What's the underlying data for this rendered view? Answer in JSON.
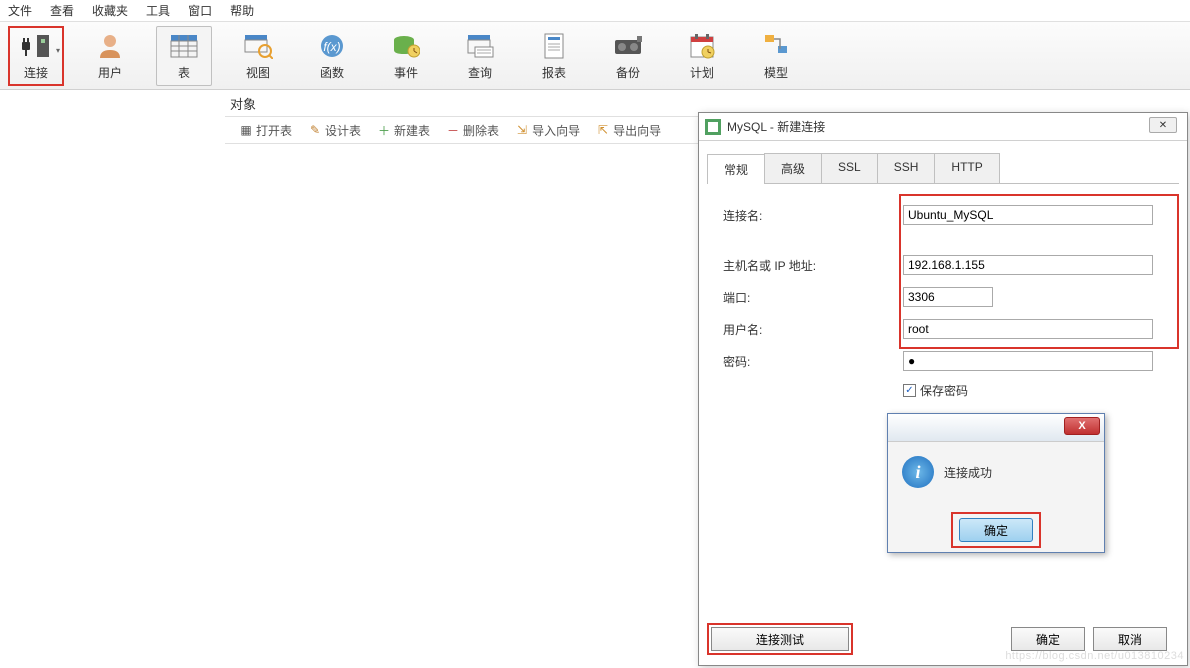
{
  "menu": {
    "file": "文件",
    "view": "查看",
    "favorites": "收藏夹",
    "tools": "工具",
    "window": "窗口",
    "help": "帮助"
  },
  "toolbar": {
    "connect": "连接",
    "user": "用户",
    "table": "表",
    "viewobj": "视图",
    "function": "函数",
    "event": "事件",
    "query": "查询",
    "report": "报表",
    "backup": "备份",
    "schedule": "计划",
    "model": "模型"
  },
  "sidebar": {
    "objects": "对象"
  },
  "subtool": {
    "open_table": "打开表",
    "design_table": "设计表",
    "new_table": "新建表",
    "delete_table": "删除表",
    "import_wizard": "导入向导",
    "export_wizard": "导出向导"
  },
  "dialog": {
    "title": "MySQL - 新建连接",
    "tabs": {
      "general": "常规",
      "advanced": "高级",
      "ssl": "SSL",
      "ssh": "SSH",
      "http": "HTTP"
    },
    "labels": {
      "conn_name": "连接名:",
      "host": "主机名或 IP 地址:",
      "port": "端口:",
      "user": "用户名:",
      "password": "密码:"
    },
    "values": {
      "conn_name": "Ubuntu_MySQL",
      "host": "192.168.1.155",
      "port": "3306",
      "user": "root",
      "password": "●"
    },
    "save_pw": "保存密码",
    "footer": {
      "test": "连接测试",
      "ok": "确定",
      "cancel": "取消"
    }
  },
  "msgbox": {
    "text": "连接成功",
    "ok": "确定"
  },
  "watermark": "https://blog.csdn.net/u013810234"
}
